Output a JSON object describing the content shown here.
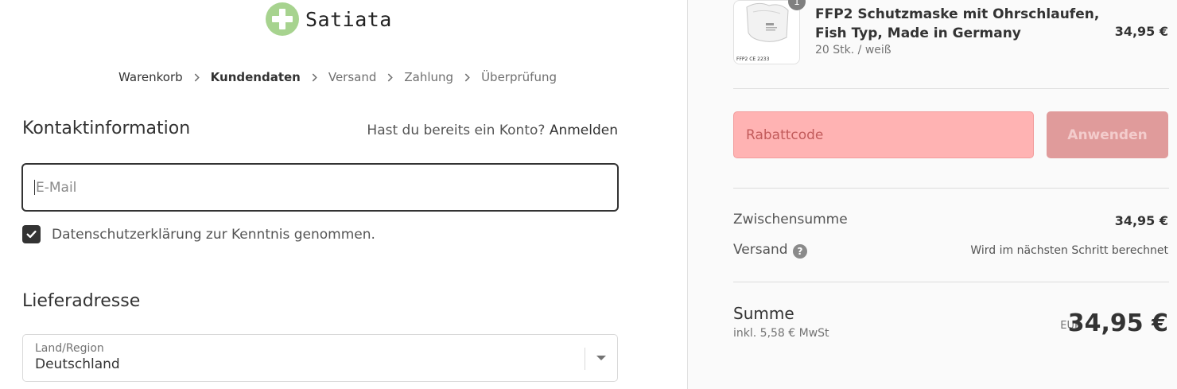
{
  "brand": {
    "name": "Satiata",
    "accent": "#a7d38f"
  },
  "breadcrumb": {
    "steps": [
      "Warenkorb",
      "Kundendaten",
      "Versand",
      "Zahlung",
      "Überprüfung"
    ],
    "current": "Kundendaten"
  },
  "contact": {
    "title": "Kontaktinformation",
    "login_prompt": "Hast du bereits ein Konto?",
    "login_link": "Anmelden",
    "email_placeholder": "E-Mail",
    "privacy_checkbox_label": "Datenschutzerklärung zur Kenntnis genommen.",
    "privacy_checked": true
  },
  "shipping_address": {
    "title": "Lieferadresse",
    "country_label": "Land/Region",
    "country_value": "Deutschland"
  },
  "order_summary": {
    "item": {
      "quantity": "1",
      "name": "FFP2 Schutzmaske mit Ohrschlaufen, Fish Typ, Made in Germany",
      "variant": "20 Stk. / weiß",
      "price": "34,95 €",
      "thumb_text": "FFP2 CE 2233"
    },
    "discount": {
      "placeholder": "Rabattcode",
      "apply_label": "Anwenden",
      "error_bg": "#ffb3b3"
    },
    "subtotal_label": "Zwischensumme",
    "subtotal_value": "34,95 €",
    "shipping_label": "Versand",
    "shipping_note": "Wird im nächsten Schritt berechnet",
    "total_label": "Summe",
    "tax_note": "inkl. 5,58 € MwSt",
    "currency": "EUR",
    "total_value": "34,95 €"
  }
}
